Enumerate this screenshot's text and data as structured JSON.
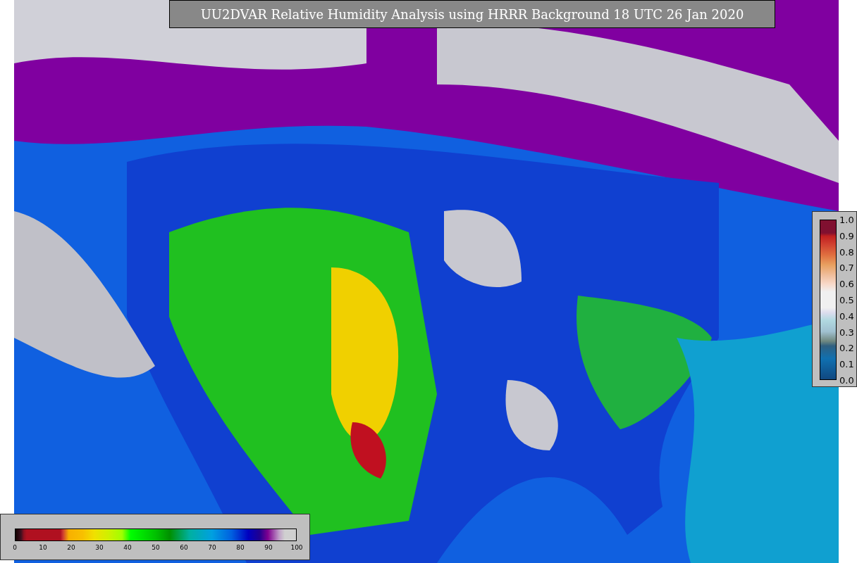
{
  "title": "UU2DVAR Relative Humidity Analysis using HRRR Background 18 UTC 26 Jan 2020",
  "observation_colorbar": {
    "ticks": [
      "1.0",
      "0.9",
      "0.8",
      "0.7",
      "0.6",
      "0.5",
      "0.4",
      "0.3",
      "0.2",
      "0.1",
      "0.0"
    ]
  },
  "humidity_colorbar": {
    "ticks": [
      "0",
      "10",
      "20",
      "30",
      "40",
      "50",
      "60",
      "70",
      "80",
      "90",
      "100"
    ]
  }
}
